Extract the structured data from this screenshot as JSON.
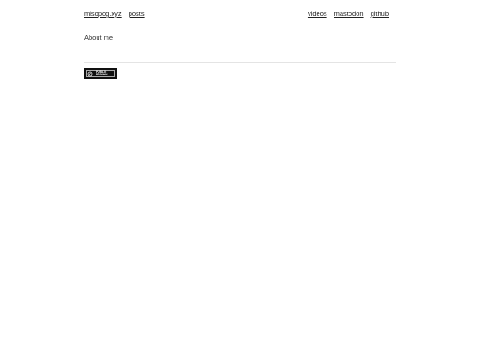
{
  "nav": {
    "left": [
      {
        "label": "misopog.xyz"
      },
      {
        "label": "posts"
      }
    ],
    "right": [
      {
        "label": "videos"
      },
      {
        "label": "mastodon"
      },
      {
        "label": "github"
      }
    ]
  },
  "main": {
    "text": "About me"
  },
  "footer": {
    "badge": {
      "icon": "public-domain-icon",
      "line1": "PUBLIC",
      "line2": "DOMAIN"
    }
  }
}
